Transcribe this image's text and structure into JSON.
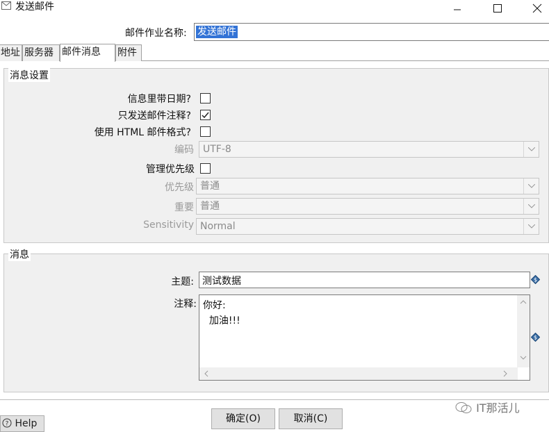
{
  "window": {
    "title": "发送邮件"
  },
  "job": {
    "name_label": "邮件作业名称:",
    "name_value": "发送邮件"
  },
  "tabs": [
    {
      "label": "地址"
    },
    {
      "label": "服务器"
    },
    {
      "label": "邮件消息",
      "active": true
    },
    {
      "label": "附件"
    }
  ],
  "settings": {
    "legend": "消息设置",
    "date_in_message": {
      "label": "信息里带日期?",
      "checked": false
    },
    "only_comment": {
      "label": "只发送邮件注释?",
      "checked": true
    },
    "html_format": {
      "label": "使用 HTML 邮件格式?",
      "checked": false
    },
    "encoding": {
      "label": "编码",
      "value": "UTF-8"
    },
    "manage_priority": {
      "label": "管理优先级",
      "checked": false
    },
    "priority": {
      "label": "优先级",
      "value": "普通"
    },
    "importance": {
      "label": "重要",
      "value": "普通"
    },
    "sensitivity": {
      "label": "Sensitivity",
      "value": "Normal"
    }
  },
  "message": {
    "legend": "消息",
    "subject_label": "主题:",
    "subject_value": "测试数据",
    "comment_label": "注释:",
    "comment_value": "你好:\n  加油!!!"
  },
  "buttons": {
    "help": "Help",
    "ok": "确定(O)",
    "cancel": "取消(C)"
  },
  "watermark": "IT那活儿"
}
